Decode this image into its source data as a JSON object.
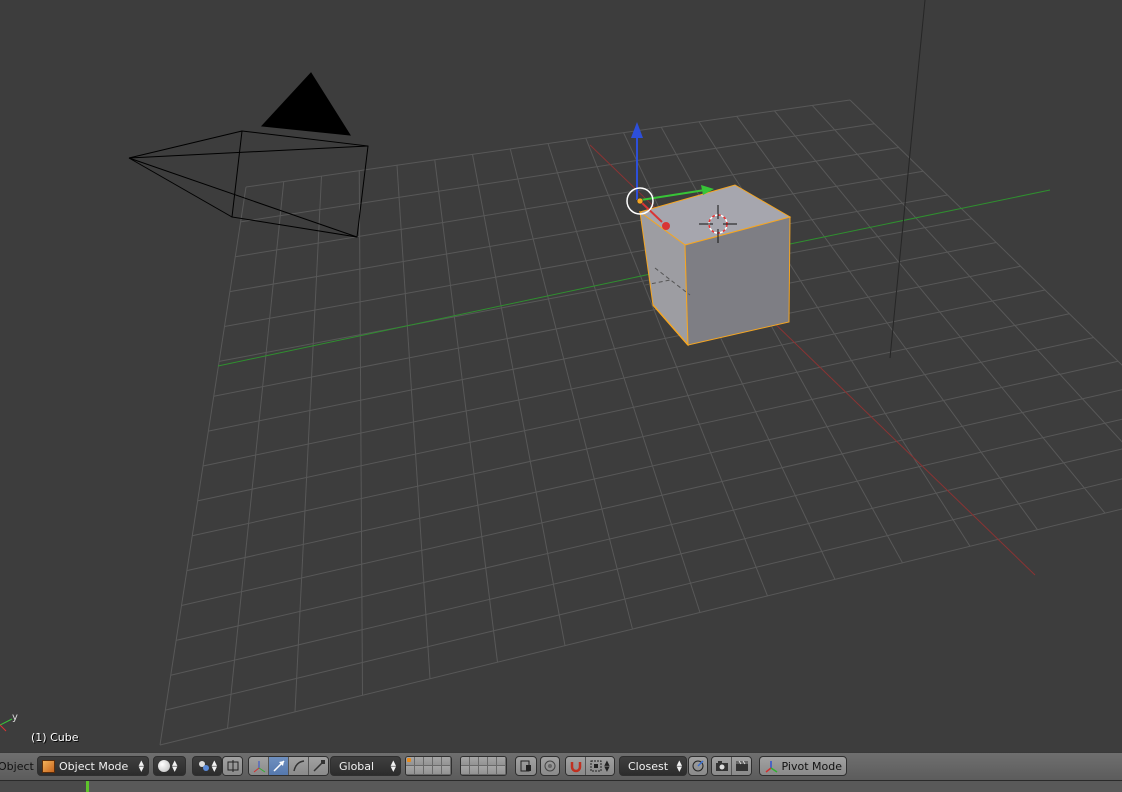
{
  "viewport": {
    "object_info": "(1) Cube",
    "axis_label_y": "y"
  },
  "header": {
    "editor_menu_label": "Object",
    "mode": {
      "value": "Object Mode",
      "icon": "cube-icon"
    },
    "shading_icon": "sphere-icon",
    "pivot_icon": "pivot-point-icon",
    "orientation": {
      "value": "Global"
    },
    "snap_target": {
      "value": "Closest"
    },
    "pivot_mode_label": "Pivot Mode"
  },
  "colors": {
    "background": "#3d3d3d",
    "grid": "#585858",
    "x_axis": "#8f2f2f",
    "y_axis": "#2e8f2e",
    "selection": "#f5a623",
    "header": "#676767"
  }
}
